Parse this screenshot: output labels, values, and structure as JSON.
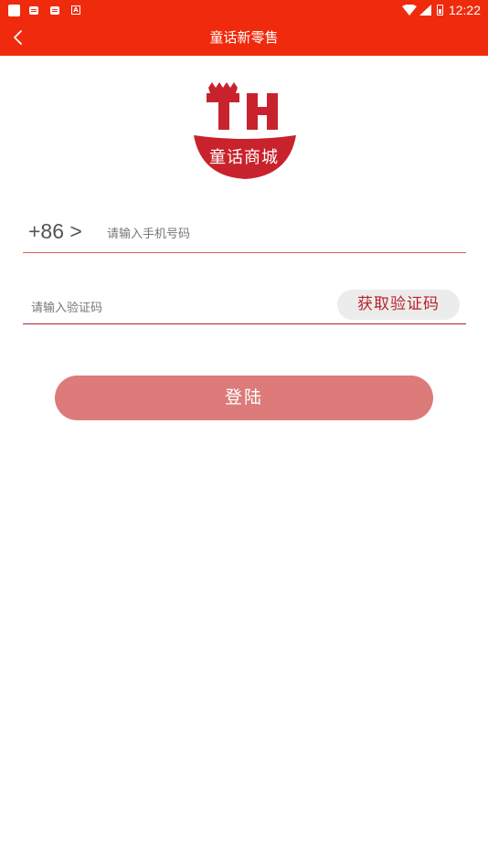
{
  "status_bar": {
    "time": "12:22",
    "icons": [
      "app-icon",
      "message-icon",
      "message-icon",
      "a-icon",
      "wifi-icon",
      "signal-icon",
      "battery-icon"
    ]
  },
  "header": {
    "title": "童话新零售",
    "back_icon": "chevron-left-icon"
  },
  "logo": {
    "text": "童话商城",
    "brand_color": "#c8232c"
  },
  "form": {
    "country_code": "+86 >",
    "phone_placeholder": "请输入手机号码",
    "code_placeholder": "请输入验证码",
    "get_code_label": "获取验证码",
    "login_label": "登陆"
  },
  "colors": {
    "accent": "#f02a0c",
    "login_button": "#dc7b7a",
    "get_code_text": "#b8232a"
  }
}
